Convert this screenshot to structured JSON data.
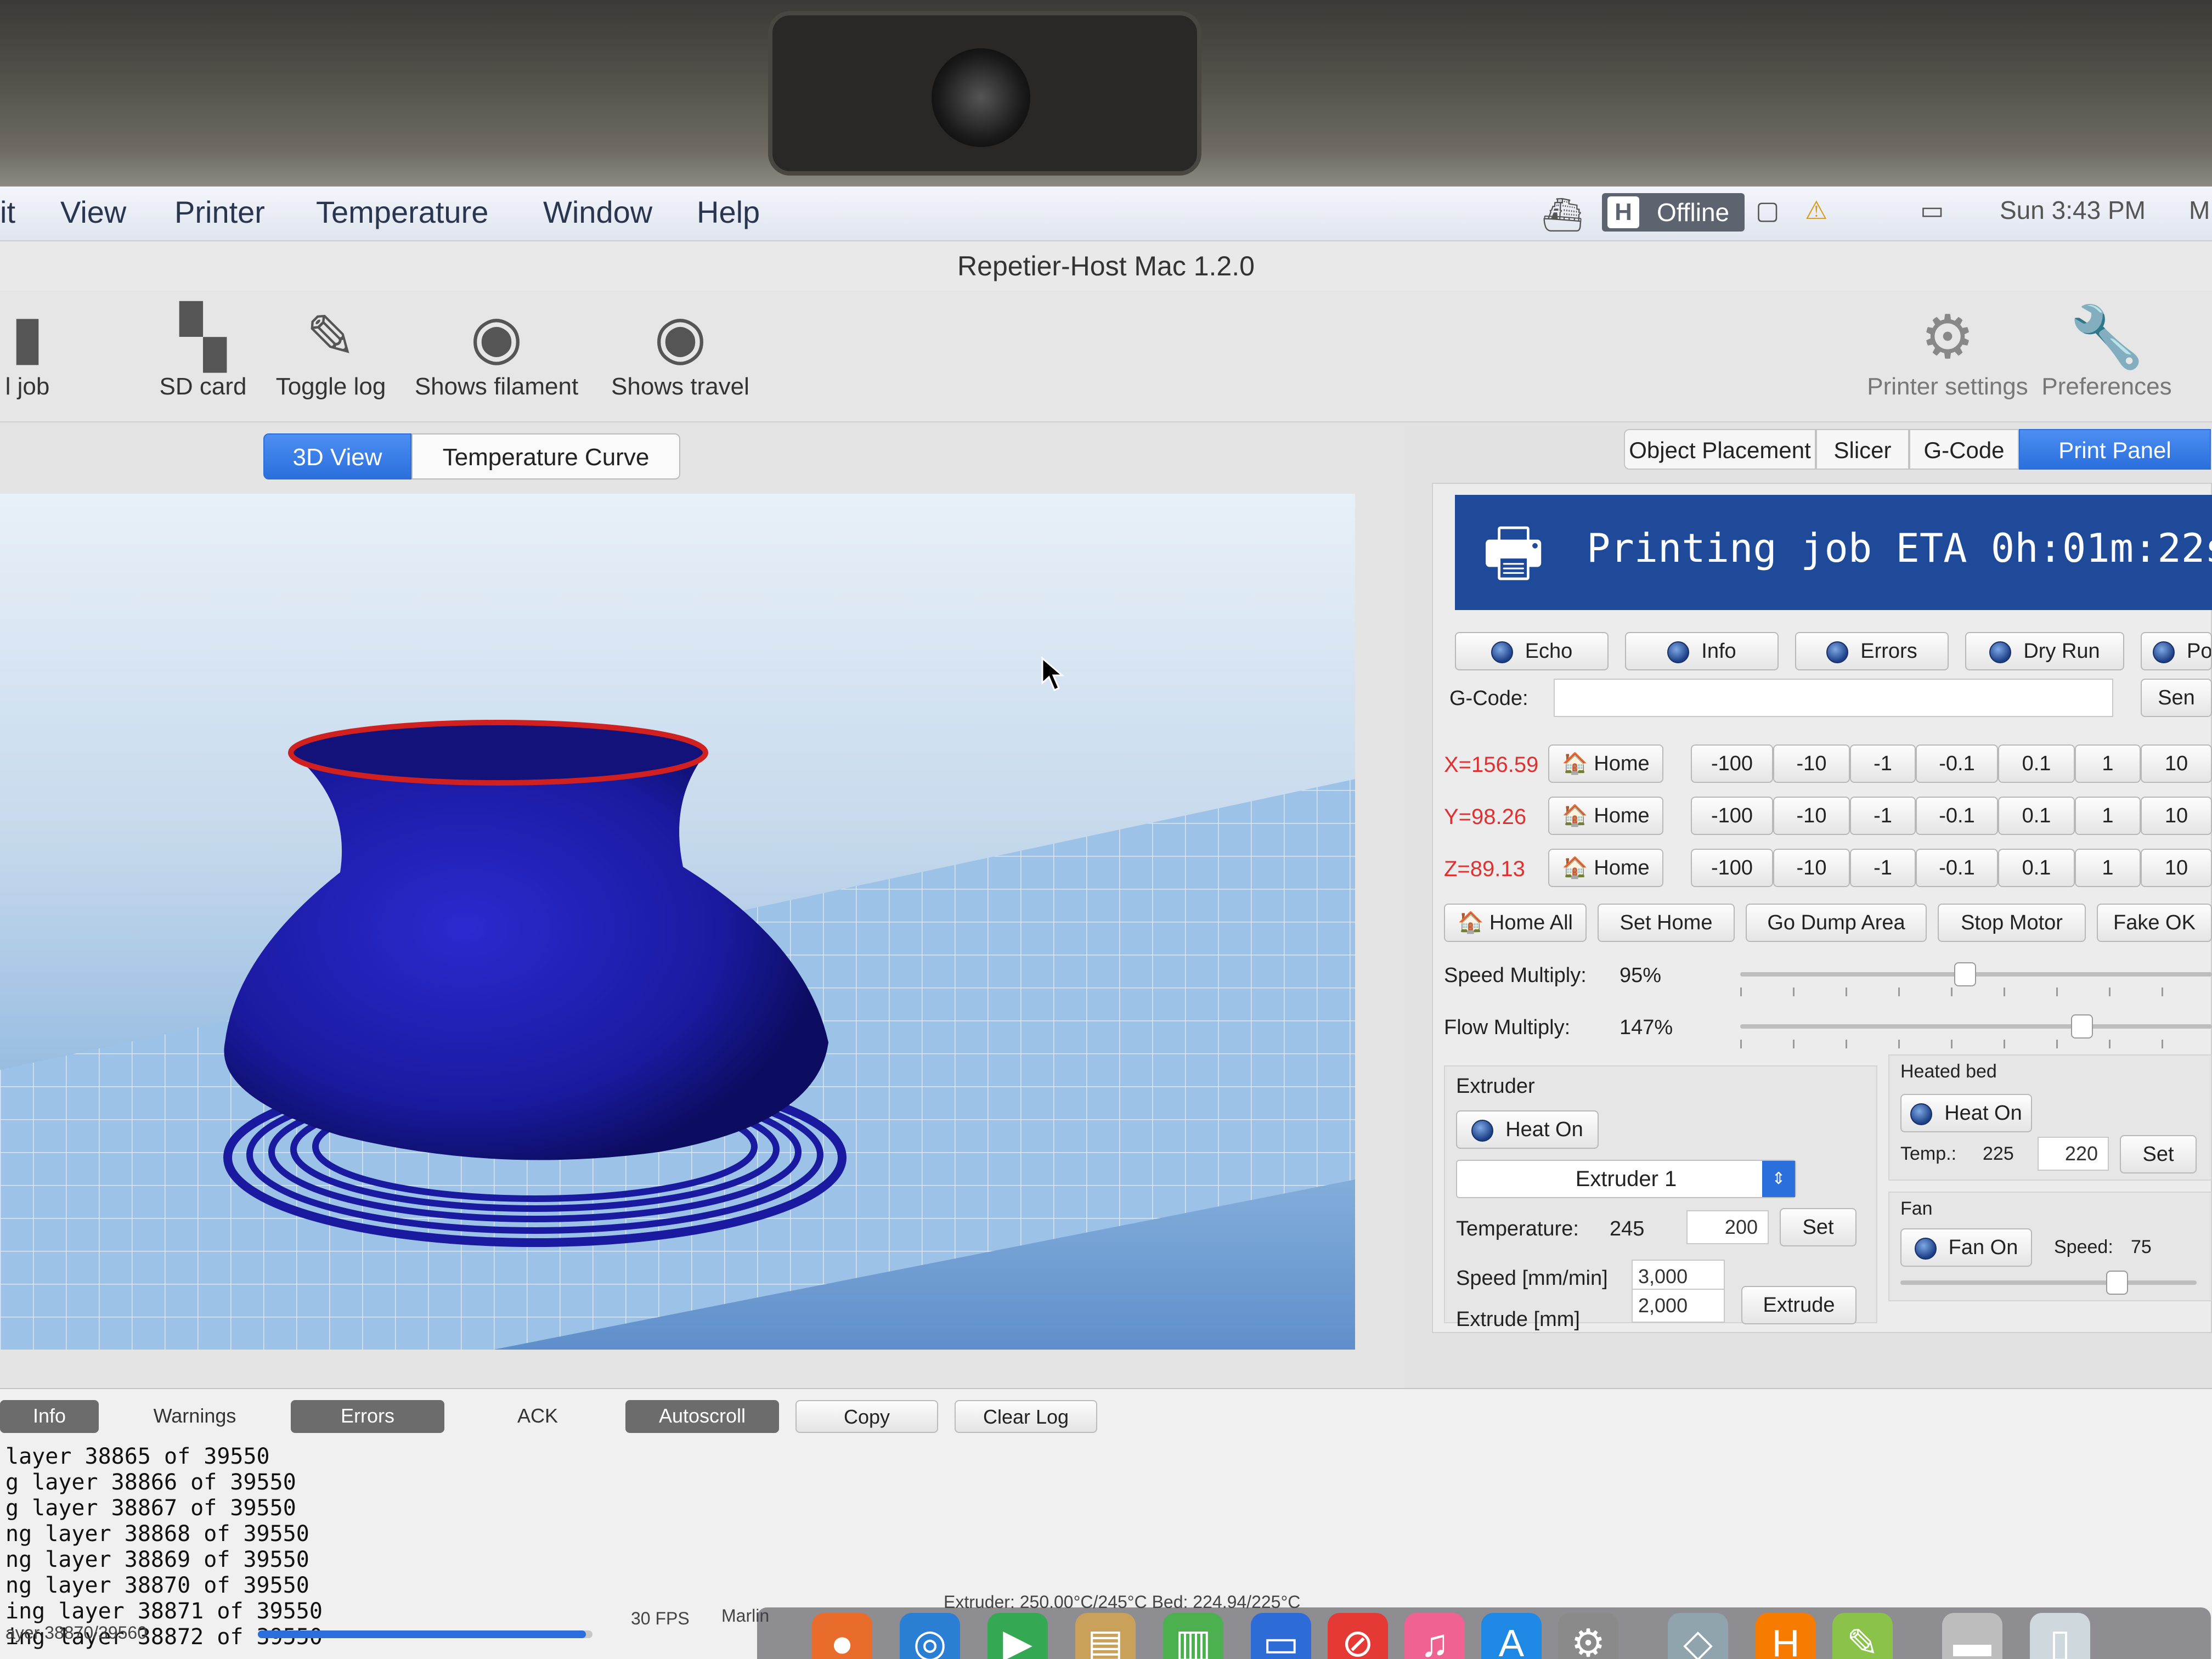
{
  "menubar": {
    "items": [
      "it",
      "View",
      "Printer",
      "Temperature",
      "Window",
      "Help"
    ],
    "status_label": "Offline",
    "status_h": "H",
    "clock": "Sun 3:43 PM",
    "user": "M"
  },
  "window": {
    "title": "Repetier-Host Mac 1.2.0"
  },
  "toolbar": {
    "left_items": [
      {
        "label": "l job",
        "icon": "job-icon"
      },
      {
        "label": "SD card",
        "icon": "sd-card-icon"
      },
      {
        "label": "Toggle log",
        "icon": "pencil-icon"
      },
      {
        "label": "Shows filament",
        "icon": "eye-icon"
      },
      {
        "label": "Shows travel",
        "icon": "eye-icon"
      }
    ],
    "right_items": [
      {
        "label": "Printer settings",
        "icon": "gear-icon"
      },
      {
        "label": "Preferences",
        "icon": "wrench-icon"
      }
    ]
  },
  "view_tabs": {
    "tab1": "3D View",
    "tab2": "Temperature Curve",
    "active": "3D View"
  },
  "right_tabs": {
    "items": [
      "Object Placement",
      "Slicer",
      "G-Code",
      "Print Panel"
    ],
    "active": "Print Panel"
  },
  "print_panel": {
    "banner": "Printing job ETA 0h:01m:22s",
    "toggles": [
      "Echo",
      "Info",
      "Errors",
      "Dry Run",
      "Po"
    ],
    "gcode_label": "G-Code:",
    "gcode_value": "",
    "send_label": "Sen",
    "x_pos": "X=156.59",
    "y_pos": "Y=98.26",
    "z_pos": "Z=89.13",
    "home_label": "Home",
    "jog_steps": [
      "-100",
      "-10",
      "-1",
      "-0.1",
      "0.1",
      "1",
      "10"
    ],
    "actions": [
      "Home All",
      "Set Home",
      "Go Dump Area",
      "Stop Motor",
      "Fake OK"
    ],
    "speed_multiply_label": "Speed Multiply:",
    "speed_multiply_value": "95%",
    "speed_multiply_pct": 95,
    "flow_multiply_label": "Flow Multiply:",
    "flow_multiply_value": "147%",
    "flow_multiply_pct": 147,
    "extruder": {
      "title": "Extruder",
      "heat_label": "Heat On",
      "selected": "Extruder 1",
      "temp_label": "Temperature:",
      "temp_current": "245",
      "temp_target": "200",
      "set_label": "Set",
      "speed_label": "Speed [mm/min]",
      "speed_value": "3,000",
      "extrude_label": "Extrude [mm]",
      "extrude_value": "2,000",
      "extrude_button": "Extrude"
    },
    "heated_bed": {
      "title": "Heated bed",
      "heat_label": "Heat On",
      "temp_label": "Temp.:",
      "temp_current": "225",
      "temp_target": "220",
      "set_label": "Set"
    },
    "fan": {
      "title": "Fan",
      "fan_label": "Fan On",
      "speed_label": "Speed:",
      "speed_value": "75"
    }
  },
  "log": {
    "filters": [
      "Info",
      "Warnings",
      "Errors",
      "ACK",
      "Autoscroll"
    ],
    "copy_label": "Copy",
    "clear_label": "Clear Log",
    "lines": [
      " layer 38865 of 39550",
      "g layer 38866 of 39550",
      "g layer 38867 of 39550",
      "ng layer 38868 of 39550",
      "ng layer 38869 of 39550",
      "ng layer 38870 of 39550",
      "ing layer 38871 of 39550",
      "ing layer 38872 of 39550"
    ]
  },
  "statusbar": {
    "progress_text": "ayer 38870/39560",
    "fps": "30 FPS",
    "firmware": "Marlin",
    "temps": "Extruder: 250.00°C/245°C Bed: 224.94/225°C"
  },
  "colors": {
    "accent": "#2b6fdc",
    "banner": "#1f4a9a",
    "coord": "#e03030",
    "model": "#1a1aa0",
    "model_rim": "#d02020"
  }
}
